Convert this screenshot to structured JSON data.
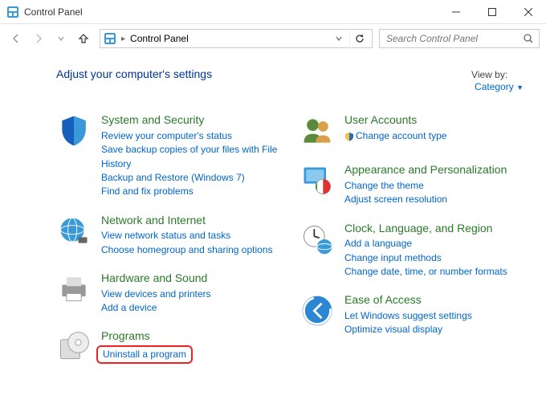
{
  "window": {
    "title": "Control Panel"
  },
  "address": {
    "path": "Control Panel"
  },
  "search": {
    "placeholder": "Search Control Panel"
  },
  "header": {
    "heading": "Adjust your computer's settings",
    "view_label": "View by:",
    "view_mode": "Category"
  },
  "left": [
    {
      "title": "System and Security",
      "links": [
        "Review your computer's status",
        "Save backup copies of your files with File History",
        "Backup and Restore (Windows 7)",
        "Find and fix problems"
      ]
    },
    {
      "title": "Network and Internet",
      "links": [
        "View network status and tasks",
        "Choose homegroup and sharing options"
      ]
    },
    {
      "title": "Hardware and Sound",
      "links": [
        "View devices and printers",
        "Add a device"
      ]
    },
    {
      "title": "Programs",
      "links": [
        "Uninstall a program"
      ]
    }
  ],
  "right": [
    {
      "title": "User Accounts",
      "links": [
        "Change account type"
      ]
    },
    {
      "title": "Appearance and Personalization",
      "links": [
        "Change the theme",
        "Adjust screen resolution"
      ]
    },
    {
      "title": "Clock, Language, and Region",
      "links": [
        "Add a language",
        "Change input methods",
        "Change date, time, or number formats"
      ]
    },
    {
      "title": "Ease of Access",
      "links": [
        "Let Windows suggest settings",
        "Optimize visual display"
      ]
    }
  ]
}
